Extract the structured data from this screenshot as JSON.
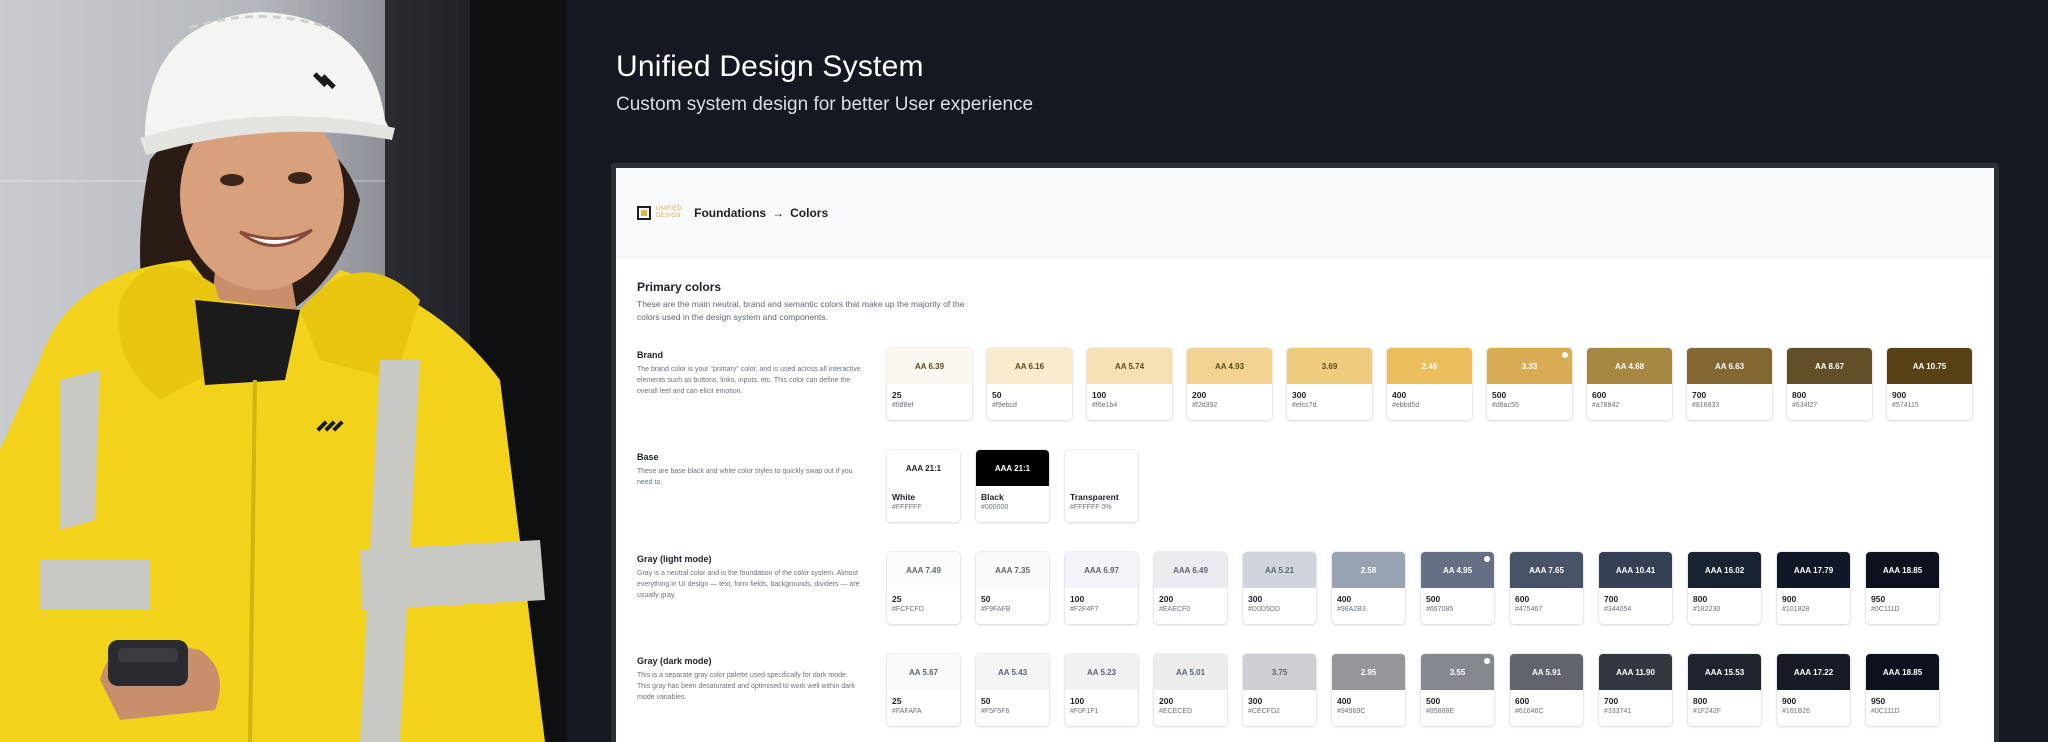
{
  "hero": {
    "title": "Unified Design System",
    "subtitle": "Custom system design for better User experience"
  },
  "app": {
    "logo_text_line1": "UNIFIED",
    "logo_text_line2": "DESIGN",
    "breadcrumb": [
      "Foundations",
      "→",
      "Colors"
    ]
  },
  "primary": {
    "title": "Primary colors",
    "description": "These are the main neutral, brand and semantic colors that make up the majority of the colors used in the design system and components."
  },
  "groups": [
    {
      "title": "Brand",
      "description": "The brand color is your \"primary\" color, and is used across all interactive elements such as buttons, links, inputs, etc. This color can define the overall feel and can elicit emotion.",
      "swatches": [
        {
          "label": "AA 6.39",
          "name": "25",
          "hex": "#fdf8ef",
          "color": "#fdf8ef",
          "text": "#5b4a1e"
        },
        {
          "label": "AA 6.16",
          "name": "50",
          "hex": "#f9ebcd",
          "color": "#f9ebcd",
          "text": "#5b4a1e"
        },
        {
          "label": "AA 5.74",
          "name": "100",
          "hex": "#f6e1b4",
          "color": "#f6e1b4",
          "text": "#5b4a1e"
        },
        {
          "label": "AA 4.93",
          "name": "200",
          "hex": "#f2d392",
          "color": "#f2d392",
          "text": "#5b4a1e"
        },
        {
          "label": "3.69",
          "name": "300",
          "hex": "#efcc7d",
          "color": "#efcc7d",
          "text": "#5b4a1e"
        },
        {
          "label": "2.49",
          "name": "400",
          "hex": "#ebbd5d",
          "color": "#ebbd5d",
          "text": "#ffffff"
        },
        {
          "label": "3.33",
          "name": "500",
          "hex": "#d8ac55",
          "color": "#d8ac55",
          "text": "#ffffff",
          "dot": true
        },
        {
          "label": "AA 4.68",
          "name": "600",
          "hex": "#a78842",
          "color": "#a78842",
          "text": "#ffffff"
        },
        {
          "label": "AA 6.63",
          "name": "700",
          "hex": "#816833",
          "color": "#816833",
          "text": "#ffffff"
        },
        {
          "label": "AA 8.67",
          "name": "800",
          "hex": "#634f27",
          "color": "#634f27",
          "text": "#ffffff"
        },
        {
          "label": "AA 10.75",
          "name": "900",
          "hex": "#574115",
          "color": "#574115",
          "text": "#ffffff"
        }
      ]
    },
    {
      "title": "Base",
      "description": "These are base black and white color styles to quickly swap out if you need to.",
      "swatches": [
        {
          "label": "AAA 21:1",
          "name": "White",
          "hex": "#FFFFFF",
          "color": "#ffffff",
          "text": "#1c2029"
        },
        {
          "label": "AAA 21:1",
          "name": "Black",
          "hex": "#000000",
          "color": "#000000",
          "text": "#ffffff"
        },
        {
          "label": "",
          "name": "Transparent",
          "hex": "#FFFFFF 0%",
          "color": "#ffffff",
          "text": "#1c2029"
        }
      ]
    },
    {
      "title": "Gray (light mode)",
      "description": "Gray is a neutral color and is the foundation of the color system. Almost everything in UI design — text, form fields, backgrounds, dividers — are usually gray.",
      "swatches": [
        {
          "label": "AAA 7.49",
          "name": "25",
          "hex": "#FCFCFD",
          "color": "#fcfcfd",
          "text": "#5f6672"
        },
        {
          "label": "AAA 7.35",
          "name": "50",
          "hex": "#F9FAFB",
          "color": "#f9fafb",
          "text": "#5f6672"
        },
        {
          "label": "AAA 6.97",
          "name": "100",
          "hex": "#F2F4F7",
          "color": "#f2f4f7",
          "text": "#5f6672"
        },
        {
          "label": "AAA 6.49",
          "name": "200",
          "hex": "#EAECF0",
          "color": "#eaecf0",
          "text": "#5f6672"
        },
        {
          "label": "AA 5.21",
          "name": "300",
          "hex": "#D0D5DD",
          "color": "#d0d5dd",
          "text": "#5f6672"
        },
        {
          "label": "2.58",
          "name": "400",
          "hex": "#98A2B3",
          "color": "#98a2b3",
          "text": "#ffffff"
        },
        {
          "label": "AA 4.95",
          "name": "500",
          "hex": "#667085",
          "color": "#667085",
          "text": "#ffffff",
          "dot": true
        },
        {
          "label": "AAA 7.65",
          "name": "600",
          "hex": "#475467",
          "color": "#475467",
          "text": "#ffffff"
        },
        {
          "label": "AAA 10.41",
          "name": "700",
          "hex": "#344054",
          "color": "#344054",
          "text": "#ffffff"
        },
        {
          "label": "AAA 16.02",
          "name": "800",
          "hex": "#182230",
          "color": "#182230",
          "text": "#ffffff"
        },
        {
          "label": "AAA 17.79",
          "name": "900",
          "hex": "#101828",
          "color": "#101828",
          "text": "#ffffff"
        },
        {
          "label": "AAA 18.85",
          "name": "950",
          "hex": "#0C111D",
          "color": "#0c111d",
          "text": "#ffffff"
        }
      ]
    },
    {
      "title": "Gray (dark mode)",
      "description": "This is a separate gray color palette used specifically for dark mode. This gray has been desaturated and optimised to work well within dark mode variables.",
      "swatches": [
        {
          "label": "AA 5.67",
          "name": "25",
          "hex": "#FAFAFA",
          "color": "#fafafa",
          "text": "#5f6672"
        },
        {
          "label": "AA 5.43",
          "name": "50",
          "hex": "#F5F5F6",
          "color": "#f5f5f6",
          "text": "#5f6672"
        },
        {
          "label": "AA 5.23",
          "name": "100",
          "hex": "#F0F1F1",
          "color": "#f0f1f1",
          "text": "#5f6672"
        },
        {
          "label": "AA 5.01",
          "name": "200",
          "hex": "#ECECED",
          "color": "#ececed",
          "text": "#5f6672"
        },
        {
          "label": "3.75",
          "name": "300",
          "hex": "#CECFD2",
          "color": "#cecfd2",
          "text": "#5f6672"
        },
        {
          "label": "2.95",
          "name": "400",
          "hex": "#94969C",
          "color": "#94969c",
          "text": "#ffffff"
        },
        {
          "label": "3.55",
          "name": "500",
          "hex": "#85888E",
          "color": "#85888e",
          "text": "#ffffff",
          "dot": true
        },
        {
          "label": "AA 5.91",
          "name": "600",
          "hex": "#61646C",
          "color": "#61646c",
          "text": "#ffffff"
        },
        {
          "label": "AAA 11.90",
          "name": "700",
          "hex": "#333741",
          "color": "#333741",
          "text": "#ffffff"
        },
        {
          "label": "AAA 15.53",
          "name": "800",
          "hex": "#1F242F",
          "color": "#1f242f",
          "text": "#ffffff"
        },
        {
          "label": "AAA 17.22",
          "name": "900",
          "hex": "#161B26",
          "color": "#161b26",
          "text": "#ffffff"
        },
        {
          "label": "AAA 18.85",
          "name": "950",
          "hex": "#0C111D",
          "color": "#0c111d",
          "text": "#ffffff"
        }
      ]
    }
  ]
}
